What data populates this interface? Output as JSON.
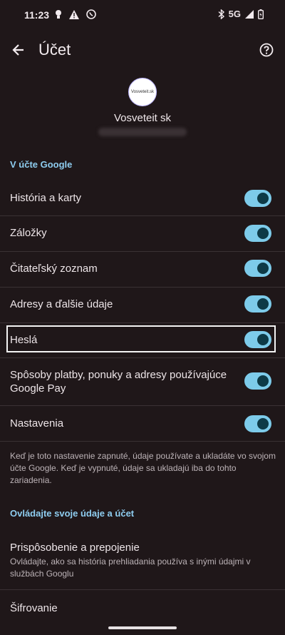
{
  "status": {
    "time": "11:23",
    "network": "5G"
  },
  "appbar": {
    "title": "Účet"
  },
  "account": {
    "avatar_text": "Vosveteit.sk",
    "name": "Vosveteit sk"
  },
  "sections": {
    "google": "V účte Google",
    "control": "Ovládajte svoje údaje a účet"
  },
  "toggles": [
    {
      "label": "História a karty",
      "on": true
    },
    {
      "label": "Záložky",
      "on": true
    },
    {
      "label": "Čitateľský zoznam",
      "on": true
    },
    {
      "label": "Adresy a ďalšie údaje",
      "on": true
    },
    {
      "label": "Heslá",
      "on": true
    },
    {
      "label": "Spôsoby platby, ponuky a adresy používajúce Google Pay",
      "on": true
    },
    {
      "label": "Nastavenia",
      "on": true
    }
  ],
  "footnote": "Keď je toto nastavenie zapnuté, údaje používate a ukladáte vo svojom účte Google. Keď je vypnuté, údaje sa ukladajú iba do tohto zariadenia.",
  "personalize": {
    "title": "Prispôsobenie a prepojenie",
    "desc": "Ovládajte, ako sa história prehliadania používa s inými údajmi v službách Googlu"
  },
  "encryption": {
    "title": "Šifrovanie"
  },
  "colors": {
    "accent": "#8ecdf0",
    "toggle_track": "#7dcbea",
    "toggle_thumb": "#0d3a47",
    "background": "#1f1719"
  }
}
